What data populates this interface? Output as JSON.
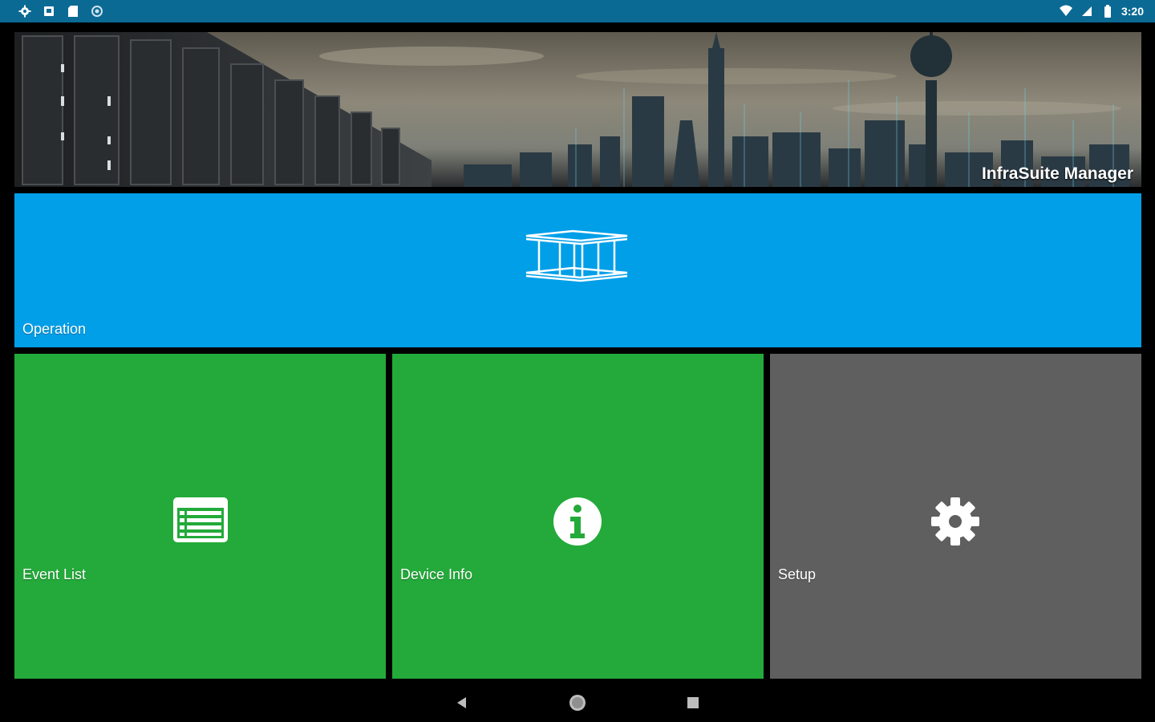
{
  "status_bar": {
    "left_icons": [
      "settings-icon",
      "photo-icon",
      "sd-card-icon",
      "sync-icon"
    ],
    "right_icons": [
      "wifi-icon",
      "signal-icon",
      "battery-icon"
    ],
    "time": "3:20"
  },
  "banner": {
    "title": "InfraSuite Manager"
  },
  "tiles": {
    "operation": {
      "label": "Operation",
      "icon": "rack-frame-icon",
      "color": "#019fe8"
    },
    "event_list": {
      "label": "Event List",
      "icon": "list-icon",
      "color": "#23aa3a"
    },
    "device_info": {
      "label": "Device Info",
      "icon": "info-icon",
      "color": "#23aa3a"
    },
    "setup": {
      "label": "Setup",
      "icon": "gear-icon",
      "color": "#5e5f5e"
    }
  },
  "nav_bar": {
    "buttons": [
      "back-icon",
      "home-icon",
      "recents-icon"
    ]
  }
}
